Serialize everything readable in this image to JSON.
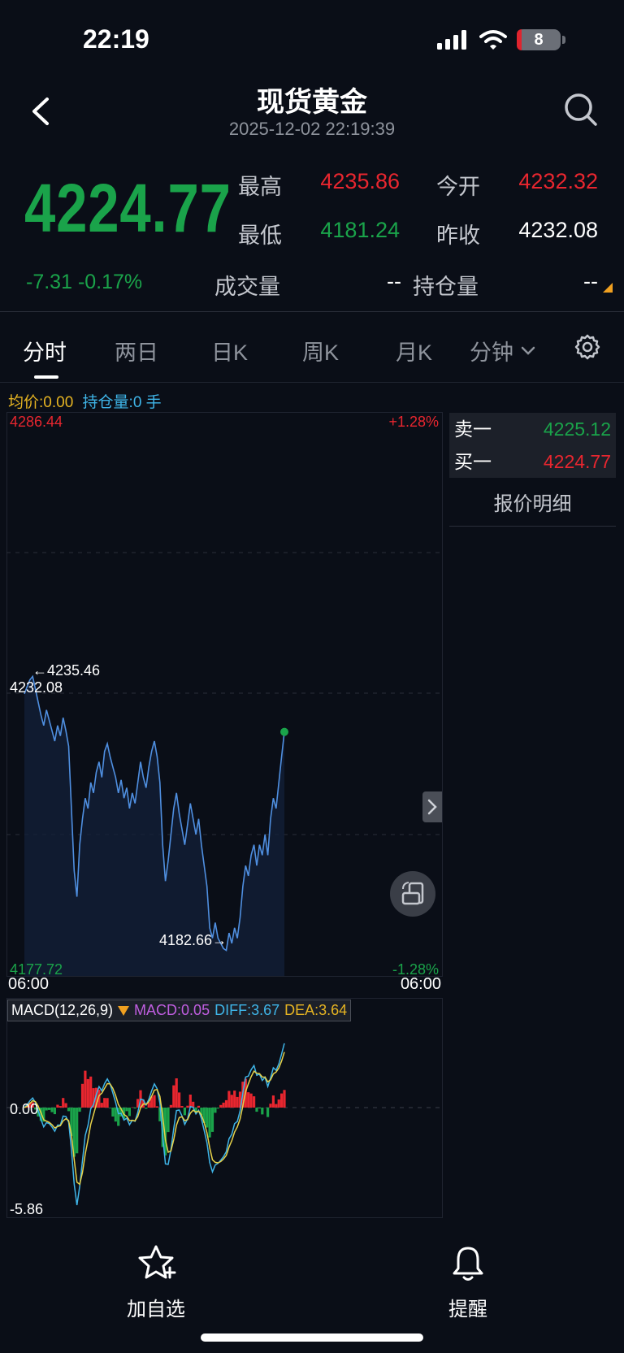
{
  "status_bar": {
    "time": "22:19",
    "battery": "8"
  },
  "header": {
    "title": "现货黄金",
    "subtitle": "2025-12-02 22:19:39"
  },
  "quote": {
    "last_price": "4224.77",
    "change": "-7.31",
    "change_pct": "-0.17%",
    "high_label": "最高",
    "high": "4235.86",
    "open_label": "今开",
    "open": "4232.32",
    "low_label": "最低",
    "low": "4181.24",
    "prev_close_label": "昨收",
    "prev_close": "4232.08",
    "volume_label": "成交量",
    "volume": "--",
    "open_interest_label": "持仓量",
    "open_interest": "--"
  },
  "tabs": [
    "分时",
    "两日",
    "日K",
    "周K",
    "月K",
    "分钟"
  ],
  "info_line": {
    "avg": "均价:0.00",
    "oi": "持仓量:0 手"
  },
  "price_chart": {
    "y_top": "4286.44",
    "y_bottom": "4177.72",
    "pct_top": "+1.28%",
    "pct_bottom": "-1.28%",
    "prev_close_label": "4232.08",
    "max_annotation": "←4235.46",
    "min_annotation": "4182.66→",
    "x_start": "06:00",
    "x_end": "06:00"
  },
  "macd": {
    "title": "MACD(12,26,9)",
    "macd": "MACD:0.05",
    "diff": "DIFF:3.67",
    "dea": "DEA:3.64",
    "zero_label": "0.00",
    "min_label": "-5.86"
  },
  "orderbook": {
    "sell_label": "卖一",
    "sell": "4225.12",
    "buy_label": "买一",
    "buy": "4224.77",
    "detail": "报价明细"
  },
  "bottom_bar": {
    "watchlist": "加自选",
    "alert": "提醒"
  },
  "colors": {
    "up": "#e8262f",
    "down": "#1aa34a",
    "line": "#4f8fe0",
    "bg": "#0a0e17"
  },
  "chart_data": {
    "type": "line",
    "ylim": [
      4177.72,
      4286.44
    ],
    "reference": 4232.08,
    "points": [
      4232.1,
      4233.5,
      4234.8,
      4235.46,
      4233.0,
      4230.5,
      4228.0,
      4226.0,
      4229.0,
      4227.0,
      4225.0,
      4223.0,
      4226.0,
      4224.0,
      4227.5,
      4225.0,
      4222.0,
      4210.0,
      4198.0,
      4193.0,
      4203.0,
      4208.0,
      4212.0,
      4210.0,
      4215.0,
      4213.0,
      4217.0,
      4219.0,
      4216.0,
      4221.0,
      4222.5,
      4220.0,
      4218.0,
      4216.0,
      4213.0,
      4215.5,
      4212.0,
      4214.0,
      4210.0,
      4213.0,
      4211.0,
      4215.0,
      4219.0,
      4216.0,
      4214.0,
      4218.0,
      4221.0,
      4223.0,
      4220.0,
      4215.0,
      4203.0,
      4196.0,
      4200.0,
      4205.0,
      4210.0,
      4213.0,
      4209.0,
      4206.0,
      4203.0,
      4207.0,
      4211.0,
      4208.0,
      4205.0,
      4208.0,
      4203.0,
      4199.0,
      4195.0,
      4187.0,
      4185.0,
      4188.0,
      4185.0,
      4184.0,
      4183.0,
      4182.66,
      4186.0,
      4184.0,
      4187.0,
      4185.0,
      4189.0,
      4195.0,
      4199.0,
      4197.0,
      4201.0,
      4203.0,
      4199.0,
      4203.0,
      4201.0,
      4205.0,
      4201.0,
      4208.0,
      4212.0,
      4210.0,
      4215.0,
      4220.0,
      4224.77
    ]
  }
}
